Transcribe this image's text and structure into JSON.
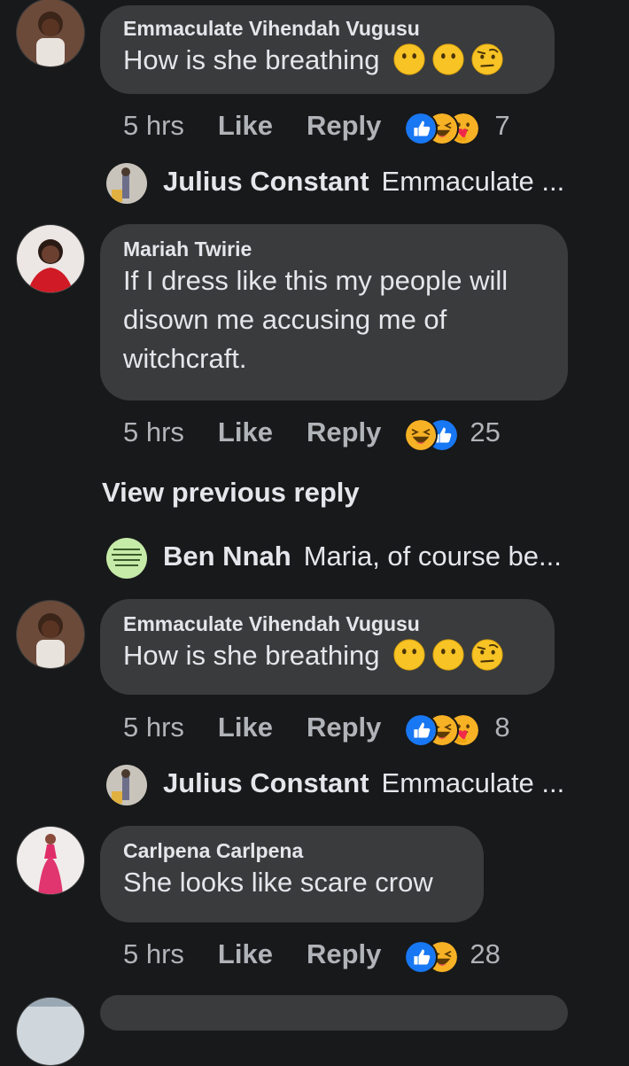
{
  "colors": {
    "background": "#18191a",
    "bubble": "#3a3b3c",
    "text": "#e4e6eb",
    "secondary": "#b0b3b8",
    "like_blue": "#1877f2",
    "haha_yellow": "#f7b125"
  },
  "comments": [
    {
      "author": "Emmaculate Vihendah Vugusu",
      "text": "How is she breathing",
      "emojis": [
        "hushed-face-icon",
        "hushed-face-icon",
        "raised-eyebrow-face-icon"
      ],
      "time": "5 hrs",
      "like": "Like",
      "reply": "Reply",
      "reactions": [
        "like-icon",
        "haha-icon",
        "care-icon"
      ],
      "count": "7"
    },
    {
      "author": "Mariah Twirie",
      "lines": [
        "If I dress like this my people will",
        "disown me accusing me of",
        "witchcraft."
      ],
      "time": "5 hrs",
      "like": "Like",
      "reply": "Reply",
      "reactions": [
        "haha-icon",
        "like-icon"
      ],
      "count": "25"
    },
    {
      "author": "Emmaculate Vihendah Vugusu",
      "text": "How is she breathing",
      "emojis": [
        "hushed-face-icon",
        "hushed-face-icon",
        "raised-eyebrow-face-icon"
      ],
      "time": "5 hrs",
      "like": "Like",
      "reply": "Reply",
      "reactions": [
        "like-icon",
        "haha-icon",
        "care-icon"
      ],
      "count": "8"
    },
    {
      "author": "Carlpena Carlpena",
      "text": "She looks like scare crow",
      "time": "5 hrs",
      "like": "Like",
      "reply": "Reply",
      "reactions": [
        "like-icon",
        "haha-icon"
      ],
      "count": "28"
    }
  ],
  "replies": [
    {
      "author": "Julius Constant",
      "text": "Emmaculate ..."
    },
    {
      "author": "Ben Nnah",
      "text": "Maria, of course be..."
    },
    {
      "author": "Julius Constant",
      "text": "Emmaculate ..."
    }
  ],
  "view_previous": "View previous reply"
}
